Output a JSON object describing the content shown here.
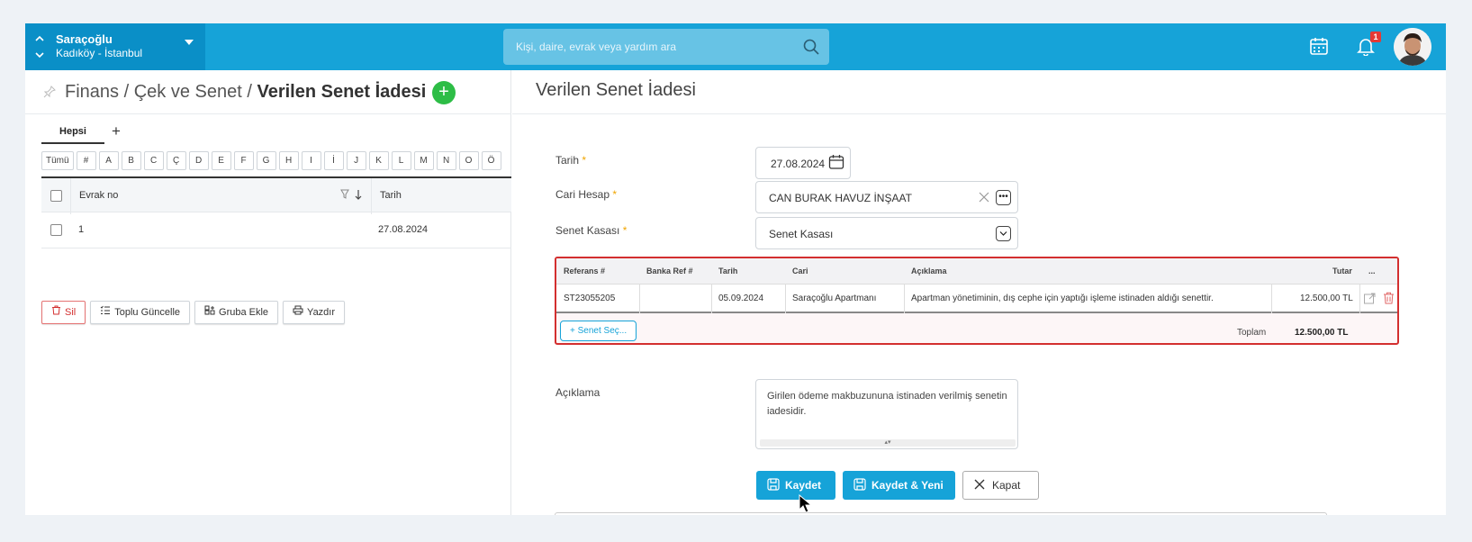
{
  "header": {
    "branch_name": "Saraçoğlu",
    "branch_location": "Kadıköy - İstanbul",
    "search_placeholder": "Kişi, daire, evrak veya yardım ara",
    "notification_count": "1",
    "colors": {
      "header": "#16a3d8",
      "branch": "#0a8fc7",
      "required": "#f0a500",
      "error": "#d32f2f",
      "success": "#2dbd46"
    }
  },
  "breadcrumb": {
    "part1": "Finans",
    "sep": " / ",
    "part2": "Çek ve Senet",
    "current": "Verilen Senet İadesi"
  },
  "left": {
    "tabs": [
      "Hepsi"
    ],
    "letters": [
      "Tümü",
      "#",
      "A",
      "B",
      "C",
      "Ç",
      "D",
      "E",
      "F",
      "G",
      "H",
      "I",
      "İ",
      "J",
      "K",
      "L",
      "M",
      "N",
      "O",
      "Ö"
    ],
    "columns": [
      "Evrak no",
      "Tarih"
    ],
    "rows": [
      {
        "evrak_no": "1",
        "tarih": "27.08.2024"
      }
    ],
    "actions": {
      "delete": "Sil",
      "bulk_update": "Toplu Güncelle",
      "add_group": "Gruba Ekle",
      "print": "Yazdır"
    }
  },
  "form": {
    "title": "Verilen Senet İadesi",
    "date_label": "Tarih",
    "date_value": "27.08.2024",
    "account_label": "Cari Hesap",
    "account_value": "CAN BURAK HAVUZ İNŞAAT",
    "cashbox_label": "Senet Kasası",
    "cashbox_value": "Senet Kasası",
    "items_table": {
      "headers": [
        "Referans #",
        "Banka Ref #",
        "Tarih",
        "Cari",
        "Açıklama",
        "Tutar",
        "..."
      ],
      "rows": [
        {
          "ref": "ST23055205",
          "bank_ref": "",
          "date": "05.09.2024",
          "cari": "Saraçoğlu Apartmanı",
          "desc": "Apartman yönetiminin, dış cephe için yaptığı işleme istinaden aldığı senettir.",
          "amount": "12.500,00 TL"
        }
      ],
      "add_button": "Senet Seç...",
      "total_label": "Toplam",
      "total_value": "12.500,00 TL"
    },
    "note_label": "Açıklama",
    "note_value": "Girilen ödeme makbuzununa istinaden verilmiş senetin iadesidir.",
    "buttons": {
      "save": "Kaydet",
      "save_new": "Kaydet & Yeni",
      "close": "Kapat"
    }
  }
}
